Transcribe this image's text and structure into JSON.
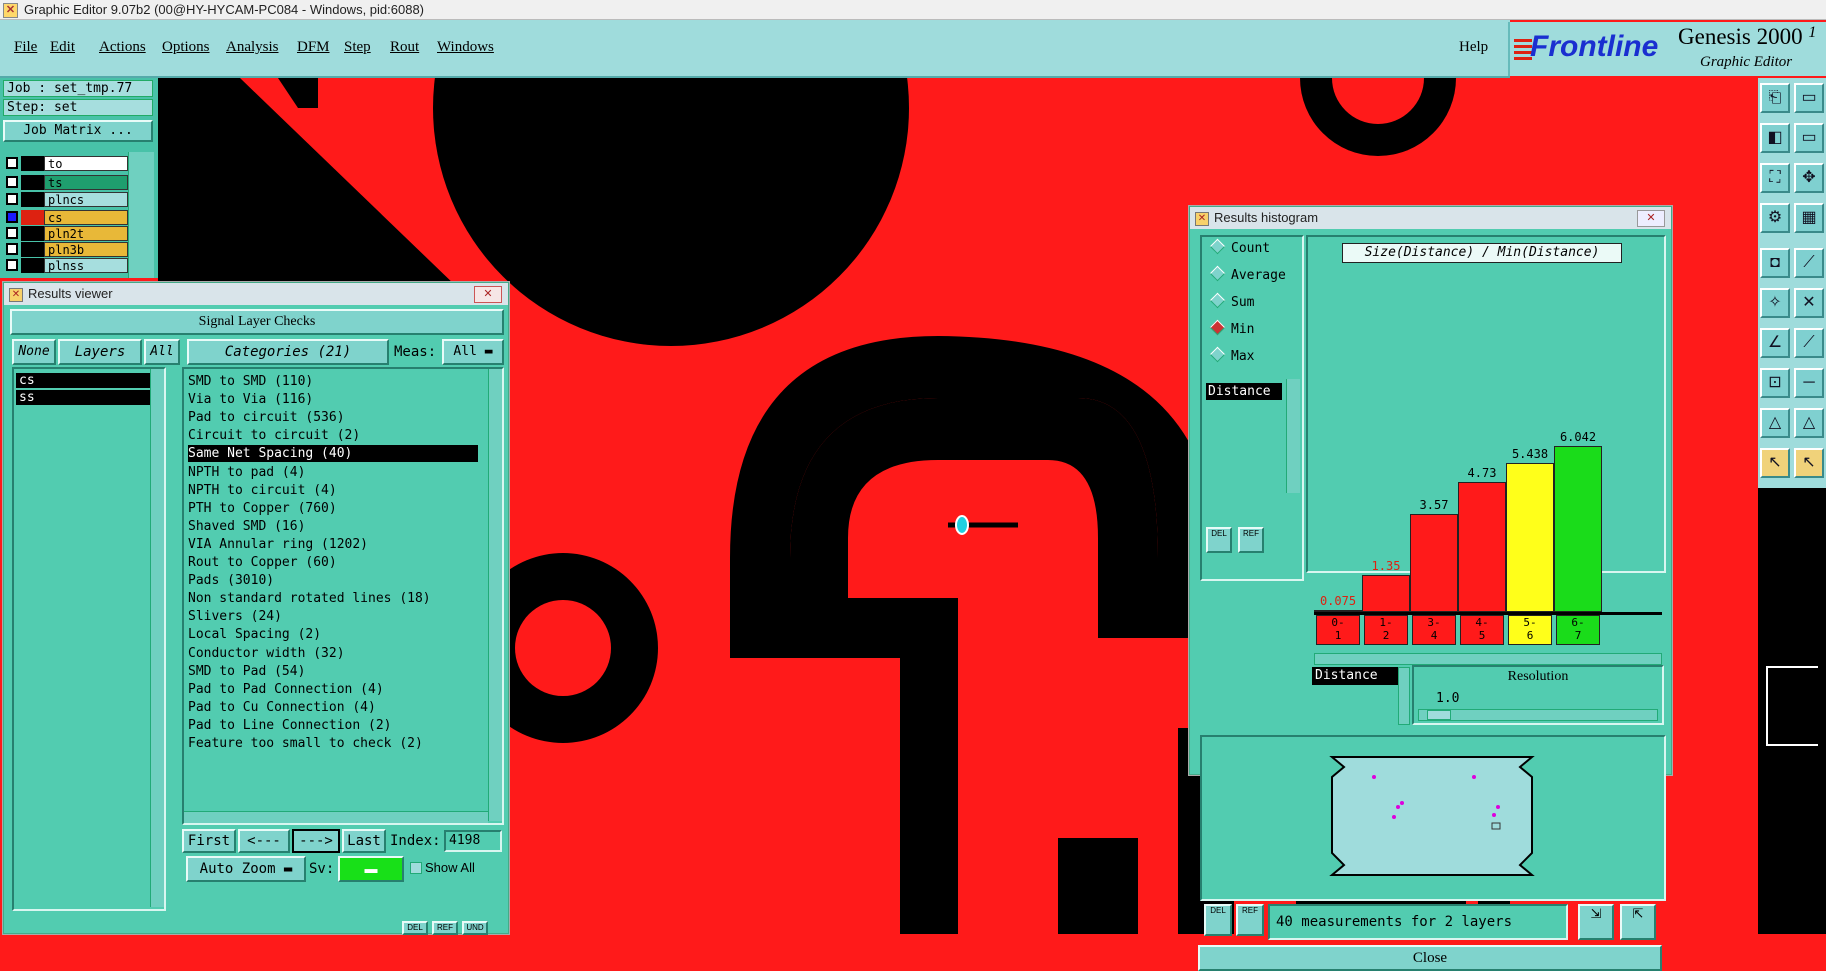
{
  "titlebar": {
    "title": "Graphic Editor 9.07b2 (00@HY-HYCAM-PC084 - Windows, pid:6088)"
  },
  "menu": {
    "items": [
      "File",
      "Edit",
      "Actions",
      "Options",
      "Analysis",
      "DFM",
      "Step",
      "Rout",
      "Windows"
    ],
    "help": "Help"
  },
  "logo": {
    "brand": "Frontline",
    "product": "Genesis 2000",
    "product_suffix": "1",
    "subtitle": "Graphic Editor"
  },
  "job": {
    "job_line": "Job : set_tmp.77",
    "step_line": "Step: set",
    "matrix_button": "Job Matrix ..."
  },
  "layers": [
    {
      "name": "to",
      "color": "#ffffff"
    },
    {
      "name": "ts",
      "color": "#1f9e6e"
    },
    {
      "name": "plncs",
      "color": "#a6dede"
    },
    {
      "name": "cs",
      "color": "#e8b838"
    },
    {
      "name": "pln2t",
      "color": "#e8b838"
    },
    {
      "name": "pln3b",
      "color": "#e8b838"
    },
    {
      "name": "plnss",
      "color": "#a6dede"
    }
  ],
  "results_viewer": {
    "title": "Results viewer",
    "heading": "Signal Layer Checks",
    "none_btn": "None",
    "layers_btn": "Layers",
    "all_btn": "All",
    "categories_btn": "Categories (21)",
    "meas_label": "Meas:",
    "meas_value": "All",
    "layer_list": [
      "cs",
      "ss"
    ],
    "categories": [
      "SMD to SMD (110)",
      "Via to Via (116)",
      "Pad to circuit (536)",
      "Circuit to circuit (2)",
      "Same Net Spacing (40)",
      "NPTH to pad (4)",
      "NPTH to circuit (4)",
      "PTH to Copper (760)",
      "Shaved SMD (16)",
      "VIA Annular ring (1202)",
      "Rout to Copper (60)",
      "Pads (3010)",
      "Non standard rotated lines (18)",
      "Slivers (24)",
      "Local Spacing (2)",
      "Conductor width (32)",
      "SMD to Pad (54)",
      "Pad to Pad Connection (4)",
      "Pad to Cu Connection (4)",
      "Pad to Line Connection (2)",
      "Feature too small to check (2)"
    ],
    "selected_index": 4,
    "first_btn": "First",
    "prev_btn": "<---",
    "next_btn": "--->",
    "last_btn": "Last",
    "index_label": "Index:",
    "index_value": "4198",
    "autozoom": "Auto Zoom",
    "sv_label": "Sv:",
    "show_all": "Show All",
    "del": "DEL",
    "ref": "REF",
    "und": "UND"
  },
  "histogram": {
    "title": "Results histogram",
    "stats": [
      "Count",
      "Average",
      "Sum",
      "Min",
      "Max"
    ],
    "stat_selected": "Min",
    "distance_label": "Distance",
    "chart_title": "Size(Distance) / Min(Distance)",
    "resolution_label": "Resolution",
    "resolution_value": "1.0",
    "distance_btn": "Distance",
    "summary": "40 measurements for 2 layers",
    "close_btn": "Close",
    "del": "DEL",
    "ref": "REF",
    "bar_colors": {
      "red": "#ff1a1a",
      "yellow": "#ffff1a",
      "green": "#1adc1a"
    }
  },
  "chart_data": {
    "type": "bar",
    "title": "Size(Distance) / Min(Distance)",
    "categories": [
      "0-1",
      "1-2",
      "3-4",
      "4-5",
      "5-6",
      "6-7"
    ],
    "category_top": [
      "0-",
      "1-",
      "3-",
      "4-",
      "5-",
      "6-"
    ],
    "category_bottom": [
      "1",
      "2",
      "4",
      "5",
      "6",
      "7"
    ],
    "values": [
      0.075,
      1.35,
      3.57,
      4.73,
      5.438,
      6.042
    ],
    "value_labels": [
      "0.075",
      "1.35",
      "3.57",
      "4.73",
      "5.438",
      "6.042"
    ],
    "colors": [
      "#ff1a1a",
      "#ff1a1a",
      "#ff1a1a",
      "#ff1a1a",
      "#ffff1a",
      "#1adc1a"
    ],
    "ylim": [
      0,
      7
    ],
    "grid": false,
    "legend": "none"
  }
}
